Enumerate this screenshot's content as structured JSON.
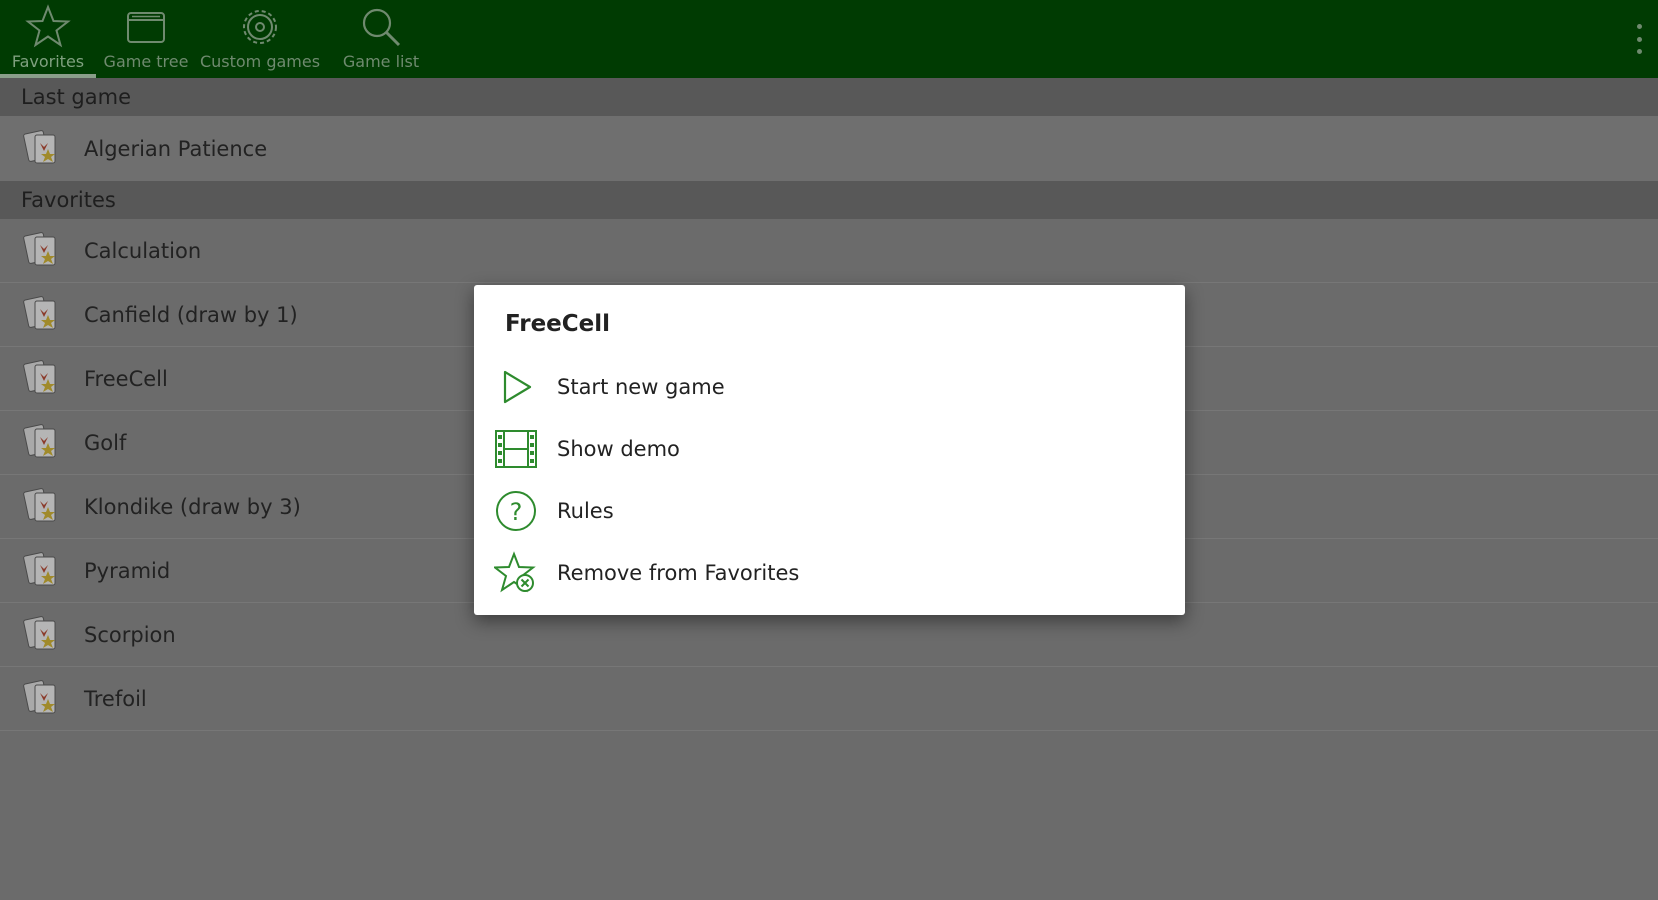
{
  "toolbar": {
    "tabs": [
      {
        "label": "Favorites",
        "icon": "star-icon"
      },
      {
        "label": "Game tree",
        "icon": "folder-icon"
      },
      {
        "label": "Custom games",
        "icon": "gear-icon"
      },
      {
        "label": "Game list",
        "icon": "search-icon"
      }
    ],
    "active_tab": "Favorites",
    "overflow_icon": "more-vert-icon"
  },
  "sections": {
    "last_game": {
      "header": "Last game",
      "items": [
        "Algerian Patience"
      ]
    },
    "favorites": {
      "header": "Favorites",
      "items": [
        "Calculation",
        "Canfield (draw by 1)",
        "FreeCell",
        "Golf",
        "Klondike (draw by 3)",
        "Pyramid",
        "Scorpion",
        "Trefoil"
      ]
    }
  },
  "dialog": {
    "title": "FreeCell",
    "items": [
      {
        "label": "Start new game",
        "icon": "play-icon"
      },
      {
        "label": "Show demo",
        "icon": "film-icon"
      },
      {
        "label": "Rules",
        "icon": "help-circle-icon"
      },
      {
        "label": "Remove from Favorites",
        "icon": "star-remove-icon"
      }
    ]
  },
  "colors": {
    "toolbar_bg": "#003b02",
    "scrim_bg": "#6b6b6b",
    "section_header_bg": "#585858",
    "accent_green": "#2e8b2e"
  }
}
